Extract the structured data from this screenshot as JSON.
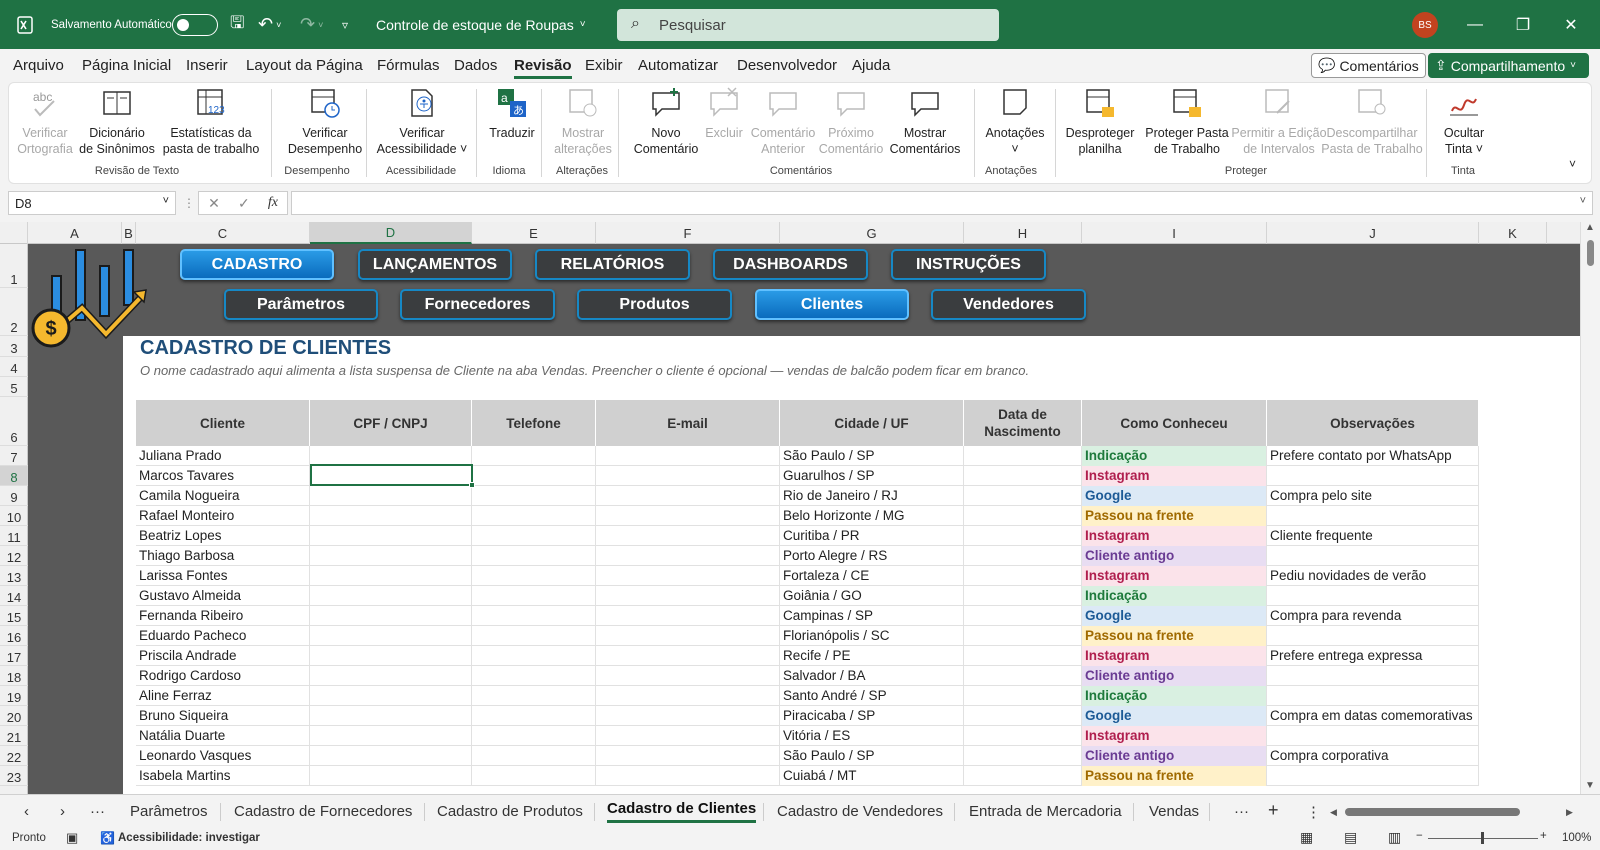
{
  "titlebar": {
    "autosave_label": "Salvamento Automático",
    "doc_title": "Controle de estoque de Roupas",
    "search_placeholder": "Pesquisar",
    "avatar_initials": "BS"
  },
  "menu": [
    "Arquivo",
    "Página Inicial",
    "Inserir",
    "Layout da Página",
    "Fórmulas",
    "Dados",
    "Revisão",
    "Exibir",
    "Automatizar",
    "Desenvolvedor",
    "Ajuda"
  ],
  "menu_active": "Revisão",
  "top_buttons": {
    "comments": "Comentários",
    "share": "Compartilhamento"
  },
  "ribbon": {
    "buttons": [
      {
        "l1": "Verificar",
        "l2": "Ortografia",
        "icon": "spellcheck-icon"
      },
      {
        "l1": "Dicionário",
        "l2": "de Sinônimos",
        "icon": "thesaurus-icon"
      },
      {
        "l1": "Estatísticas da",
        "l2": "pasta de trabalho",
        "icon": "workbook-stats-icon"
      },
      {
        "l1": "Verificar",
        "l2": "Desempenho",
        "icon": "performance-icon"
      },
      {
        "l1": "Verificar",
        "l2": "Acessibilidade ˅",
        "icon": "accessibility-icon"
      },
      {
        "l1": "Traduzir",
        "l2": "",
        "icon": "translate-icon"
      },
      {
        "l1": "Mostrar",
        "l2": "alterações",
        "icon": "show-changes-icon"
      },
      {
        "l1": "Novo",
        "l2": "Comentário",
        "icon": "new-comment-icon"
      },
      {
        "l1": "Excluir",
        "l2": "",
        "icon": "delete-comment-icon"
      },
      {
        "l1": "Comentário",
        "l2": "Anterior",
        "icon": "previous-comment-icon"
      },
      {
        "l1": "Próximo",
        "l2": "Comentário",
        "icon": "next-comment-icon"
      },
      {
        "l1": "Mostrar",
        "l2": "Comentários",
        "icon": "show-comments-icon"
      },
      {
        "l1": "Anotações",
        "l2": "˅",
        "icon": "notes-icon"
      },
      {
        "l1": "Desproteger",
        "l2": "planilha",
        "icon": "unprotect-sheet-icon"
      },
      {
        "l1": "Proteger Pasta",
        "l2": "de Trabalho",
        "icon": "protect-workbook-icon"
      },
      {
        "l1": "Permitir a Edição",
        "l2": "de Intervalos",
        "icon": "allow-edit-ranges-icon"
      },
      {
        "l1": "Descompartilhar",
        "l2": "Pasta de Trabalho",
        "icon": "unshare-workbook-icon"
      },
      {
        "l1": "Ocultar",
        "l2": "Tinta ˅",
        "icon": "hide-ink-icon"
      }
    ],
    "groups": [
      "Revisão de Texto",
      "Desempenho",
      "Acessibilidade",
      "Idioma",
      "Alterações",
      "Comentários",
      "Anotações",
      "Proteger",
      "Tinta"
    ]
  },
  "formula_bar": {
    "name_box": "D8",
    "fx": "fx",
    "content": ""
  },
  "columns": [
    "A",
    "B",
    "C",
    "D",
    "E",
    "F",
    "G",
    "H",
    "I",
    "J",
    "K"
  ],
  "selected_column": "D",
  "rows": [
    "1",
    "2",
    "3",
    "4",
    "5",
    "6",
    "7",
    "8",
    "9",
    "10",
    "11",
    "12",
    "13",
    "14",
    "15",
    "16",
    "17",
    "18",
    "19",
    "20",
    "21",
    "22",
    "23"
  ],
  "selected_row": "8",
  "nav": {
    "top": [
      "CADASTRO",
      "LANÇAMENTOS",
      "RELATÓRIOS",
      "DASHBOARDS",
      "INSTRUÇÕES"
    ],
    "top_active": "CADASTRO",
    "sub": [
      "Parâmetros",
      "Fornecedores",
      "Produtos",
      "Clientes",
      "Vendedores"
    ],
    "sub_active": "Clientes"
  },
  "sheet": {
    "title": "CADASTRO DE CLIENTES",
    "subtitle": "O nome cadastrado aqui alimenta a lista suspensa de Cliente na aba Vendas. Preencher o cliente é opcional — vendas de balcão podem ficar em branco.",
    "headers": [
      "Cliente",
      "CPF / CNPJ",
      "Telefone",
      "E-mail",
      "Cidade / UF",
      "Data de Nascimento",
      "Como Conheceu",
      "Observações"
    ],
    "records": [
      [
        "Juliana Prado",
        "",
        "",
        "",
        "São Paulo / SP",
        "",
        "Indicação",
        "Prefere contato por WhatsApp"
      ],
      [
        "Marcos Tavares",
        "",
        "",
        "",
        "Guarulhos / SP",
        "",
        "Instagram",
        ""
      ],
      [
        "Camila Nogueira",
        "",
        "",
        "",
        "Rio de Janeiro / RJ",
        "",
        "Google",
        "Compra pelo site"
      ],
      [
        "Rafael Monteiro",
        "",
        "",
        "",
        "Belo Horizonte / MG",
        "",
        "Passou na frente",
        ""
      ],
      [
        "Beatriz Lopes",
        "",
        "",
        "",
        "Curitiba / PR",
        "",
        "Instagram",
        "Cliente frequente"
      ],
      [
        "Thiago Barbosa",
        "",
        "",
        "",
        "Porto Alegre / RS",
        "",
        "Cliente antigo",
        ""
      ],
      [
        "Larissa Fontes",
        "",
        "",
        "",
        "Fortaleza / CE",
        "",
        "Instagram",
        "Pediu novidades de verão"
      ],
      [
        "Gustavo Almeida",
        "",
        "",
        "",
        "Goiânia / GO",
        "",
        "Indicação",
        ""
      ],
      [
        "Fernanda Ribeiro",
        "",
        "",
        "",
        "Campinas / SP",
        "",
        "Google",
        "Compra para revenda"
      ],
      [
        "Eduardo Pacheco",
        "",
        "",
        "",
        "Florianópolis / SC",
        "",
        "Passou na frente",
        ""
      ],
      [
        "Priscila Andrade",
        "",
        "",
        "",
        "Recife / PE",
        "",
        "Instagram",
        "Prefere entrega expressa"
      ],
      [
        "Rodrigo Cardoso",
        "",
        "",
        "",
        "Salvador / BA",
        "",
        "Cliente antigo",
        ""
      ],
      [
        "Aline Ferraz",
        "",
        "",
        "",
        "Santo André / SP",
        "",
        "Indicação",
        ""
      ],
      [
        "Bruno Siqueira",
        "",
        "",
        "",
        "Piracicaba / SP",
        "",
        "Google",
        "Compra em datas comemorativas"
      ],
      [
        "Natália Duarte",
        "",
        "",
        "",
        "Vitória / ES",
        "",
        "Instagram",
        ""
      ],
      [
        "Leonardo Vasques",
        "",
        "",
        "",
        "São Paulo / SP",
        "",
        "Cliente antigo",
        "Compra corporativa"
      ],
      [
        "Isabela Martins",
        "",
        "",
        "",
        "Cuiabá / MT",
        "",
        "Passou na frente",
        ""
      ]
    ],
    "tag_colors": {
      "Indicação": {
        "bg": "#d9f0e1",
        "fg": "#1e7a3c"
      },
      "Instagram": {
        "bg": "#fbe3ea",
        "fg": "#b01e4e"
      },
      "Google": {
        "bg": "#dce9f6",
        "fg": "#1d5a96"
      },
      "Passou na frente": {
        "bg": "#fff1c9",
        "fg": "#a06a00"
      },
      "Cliente antigo": {
        "bg": "#e8ddf2",
        "fg": "#6a3b93"
      }
    }
  },
  "sheet_tabs": [
    "Parâmetros",
    "Cadastro de Fornecedores",
    "Cadastro de Produtos",
    "Cadastro de Clientes",
    "Cadastro de Vendedores",
    "Entrada de Mercadoria",
    "Vendas"
  ],
  "active_tab": "Cadastro de Clientes",
  "status": {
    "ready": "Pronto",
    "accessibility": "Acessibilidade: investigar",
    "zoom": "100%"
  }
}
